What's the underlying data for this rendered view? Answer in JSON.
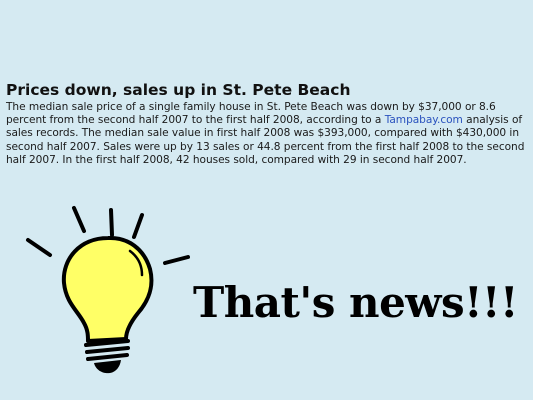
{
  "article": {
    "headline": "Prices down, sales up in St. Pete Beach",
    "body_before_link": "The median sale price of a single family house in St. Pete Beach was down by $37,000 or 8.6 percent from the second half 2007 to the first half 2008, according to a ",
    "link_text": "Tampabay.com",
    "body_after_link": " analysis of sales records. The median sale value in first half 2008 was $393,000, compared with $430,000 in second half 2007. Sales were up by 13 sales or 44.8 percent from the first half 2008 to the second half 2007. In the first half 2008, 42 houses sold, compared with 29 in second half 2007."
  },
  "caption": "That's news!!!",
  "colors": {
    "background": "#d5eaf2",
    "bulb_fill": "#ffff66",
    "link": "#2a52be"
  },
  "icons": [
    "lightbulb-icon"
  ]
}
